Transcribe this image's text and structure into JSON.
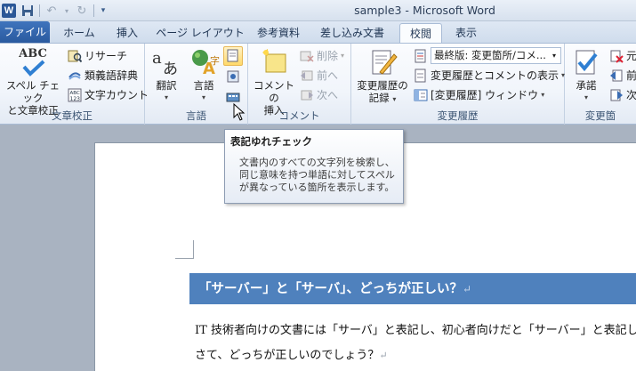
{
  "titlebar": {
    "title": "sample3 - Microsoft Word",
    "app_icon_letter": "W"
  },
  "tabs": [
    {
      "label": "ファイル",
      "active": false
    },
    {
      "label": "ホーム",
      "active": false
    },
    {
      "label": "挿入",
      "active": false
    },
    {
      "label": "ページ レイアウト",
      "active": false
    },
    {
      "label": "参考資料",
      "active": false
    },
    {
      "label": "差し込み文書",
      "active": false
    },
    {
      "label": "校閲",
      "active": true
    },
    {
      "label": "表示",
      "active": false
    }
  ],
  "ribbon": {
    "proofing": {
      "label": "文章校正",
      "spell_check_label_1": "スペル チェック",
      "spell_check_label_2": "と文章校正",
      "research": "リサーチ",
      "thesaurus": "類義語辞典",
      "word_count": "文字カウント"
    },
    "language": {
      "label": "言語",
      "translate": "翻訳",
      "language": "言語"
    },
    "comments": {
      "label": "コメント",
      "new_comment_1": "コメントの",
      "new_comment_2": "挿入",
      "delete": "削除",
      "previous": "前へ",
      "next": "次へ"
    },
    "tracking": {
      "label": "変更履歴",
      "track_changes_1": "変更履歴の",
      "track_changes_2": "記録",
      "display_for_review": "最終版: 変更箇所/コメ...",
      "show_markup": "変更履歴とコメントの表示",
      "reviewing_pane": "[変更履歴] ウィンドウ"
    },
    "changes": {
      "label": "変更箇",
      "accept": "承諾",
      "reject_partial": "元",
      "previous_partial": "前",
      "next_partial": "次"
    }
  },
  "tooltip": {
    "title": "表記ゆれチェック",
    "line1": "文書内のすべての文字列を検索し、",
    "line2": "同じ意味を持つ単語に対してスペル",
    "line3": "が異なっている箇所を表示します。"
  },
  "document": {
    "heading": "「サーバー」と「サーバ」、どっちが正しい？",
    "body_line1": "IT 技術者向けの文書には「サーバ」と表記し、初心者向けだと「サーバー」と表記し",
    "body_line2": "さて、どっちが正しいのでしょう？"
  },
  "colors": {
    "file_tab": "#2a5a9f",
    "heading_fill": "#4f81bd"
  }
}
